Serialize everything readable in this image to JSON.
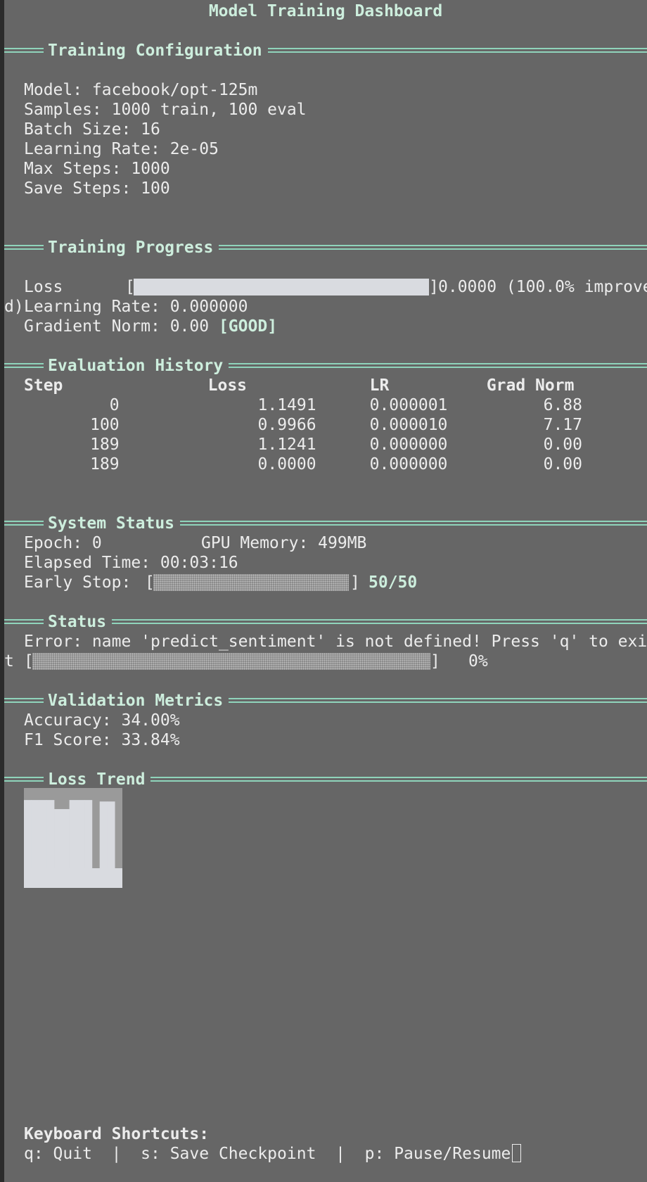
{
  "title": "Model Training Dashboard",
  "sections": {
    "config": "Training Configuration",
    "progress": "Training Progress",
    "history": "Evaluation History",
    "system": "System Status",
    "status": "Status",
    "validation": "Validation Metrics",
    "trend": "Loss Trend"
  },
  "config": {
    "model": "Model: facebook/opt-125m",
    "samples": "Samples: 1000 train, 100 eval",
    "batch_size": "Batch Size: 16",
    "learning_rate": "Learning Rate: 2e-05",
    "max_steps": "Max Steps: 1000",
    "save_steps": "Save Steps: 100"
  },
  "progress": {
    "loss_label": "Loss",
    "loss_fill_fraction": 1.0,
    "loss_value": "0.0000 (100.0% improve",
    "loss_wrap": "d)",
    "learning_rate": "Learning Rate: 0.000000",
    "grad_norm_label": "Gradient Norm: 0.00 ",
    "grad_norm_status": "[GOOD]"
  },
  "history": {
    "headers": [
      "Step",
      "Loss",
      "LR",
      "Grad Norm"
    ],
    "rows": [
      [
        "0",
        "1.1491",
        "0.000001",
        "6.88"
      ],
      [
        "100",
        "0.9966",
        "0.000010",
        "7.17"
      ],
      [
        "189",
        "1.1241",
        "0.000000",
        "0.00"
      ],
      [
        "189",
        "0.0000",
        "0.000000",
        "0.00"
      ]
    ]
  },
  "system": {
    "epoch": "Epoch: 0",
    "gpu_memory": "GPU Memory: 499MB",
    "elapsed": "Elapsed Time: 00:03:16",
    "early_stop_label": "Early Stop: ",
    "early_stop_count": "50/50"
  },
  "status": {
    "message": "Error: name 'predict_sentiment' is not defined! Press 'q' to exi",
    "message_wrap": "t ",
    "percent": "0%",
    "progress_fraction": 0.0
  },
  "validation": {
    "accuracy": "Accuracy: 34.00%",
    "f1": "F1 Score: 33.84%"
  },
  "loss_trend": {
    "values": [
      1.1491,
      1.1491,
      1.1491,
      1.1491,
      0.9966,
      0.9966,
      1.1491,
      1.1491,
      1.1491,
      0.0,
      1.1241,
      1.1241,
      0.0
    ],
    "max": 1.1491
  },
  "shortcuts": {
    "heading": "Keyboard Shortcuts:",
    "line": "q: Quit  |  s: Save Checkpoint  |  p: Pause/Resume"
  },
  "colors": {
    "background": "#666666",
    "accent": "#cdeedd",
    "rule": "#8fd4bb",
    "bar": "#d9dbe0"
  }
}
